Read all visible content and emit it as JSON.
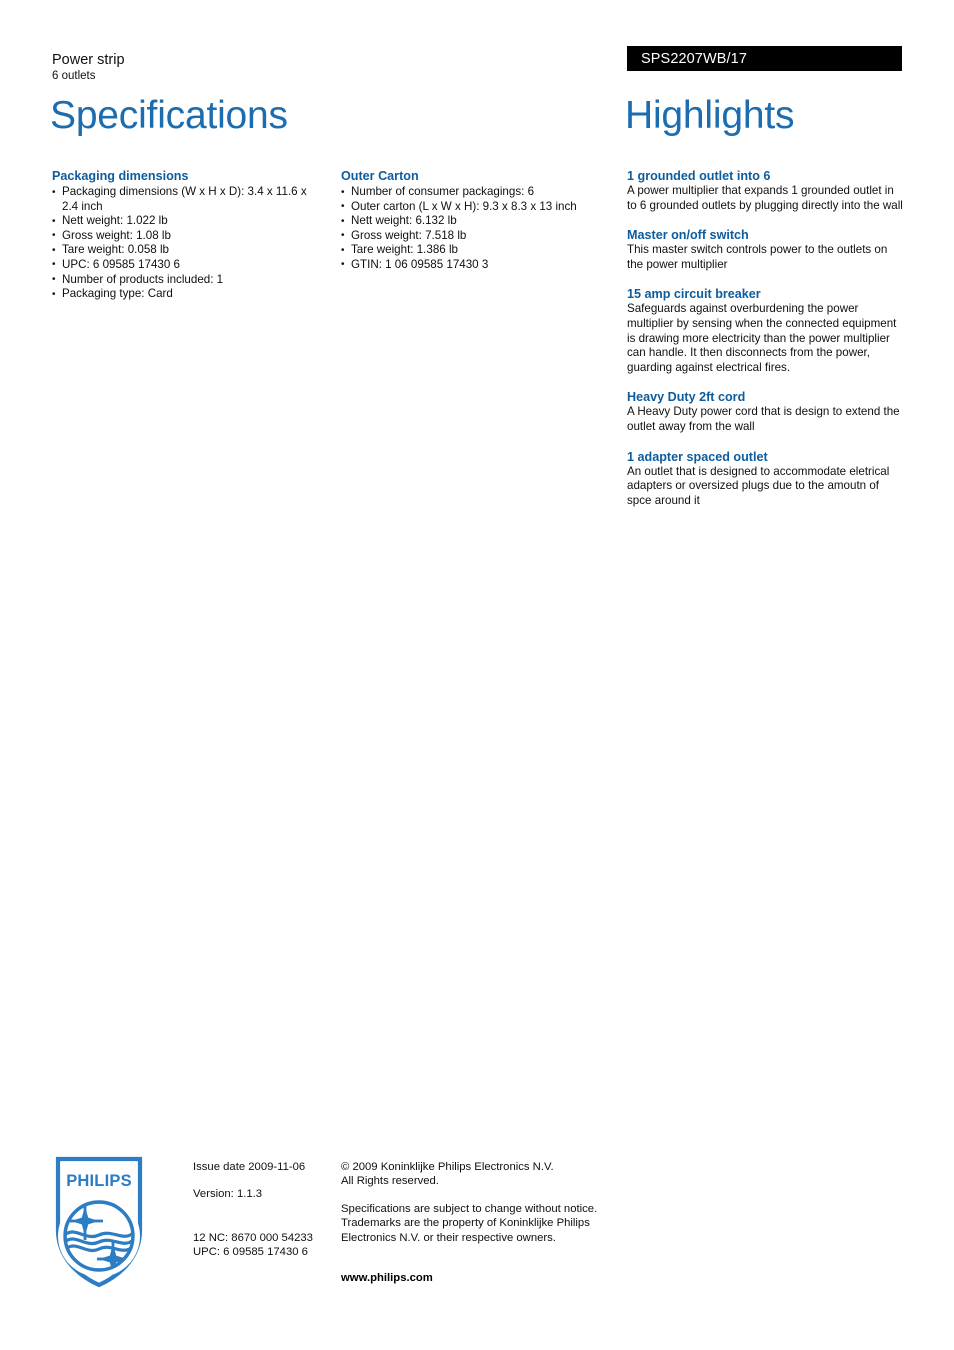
{
  "header": {
    "product_name": "Power strip",
    "product_subtitle": "6 outlets",
    "product_code": "SPS2207WB/17"
  },
  "titles": {
    "specifications": "Specifications",
    "highlights": "Highlights"
  },
  "colors": {
    "title_blue": "#1c6cb0",
    "heading_blue": "#0d5c9e",
    "banner_black": "#000000",
    "logo_blue": "#2d7dc4"
  },
  "specs": {
    "packaging": {
      "heading": "Packaging dimensions",
      "items": [
        "Packaging dimensions (W x H x D): 3.4 x 11.6 x 2.4 inch",
        "Nett weight: 1.022 lb",
        "Gross weight: 1.08 lb",
        "Tare weight: 0.058 lb",
        "UPC: 6 09585 17430 6",
        "Number of products included: 1",
        "Packaging type: Card"
      ]
    },
    "outer_carton": {
      "heading": "Outer Carton",
      "items": [
        "Number of consumer packagings: 6",
        "Outer carton (L x W x H): 9.3 x 8.3 x 13 inch",
        "Nett weight: 6.132 lb",
        "Gross weight: 7.518 lb",
        "Tare weight: 1.386 lb",
        "GTIN: 1 06 09585 17430 3"
      ]
    }
  },
  "highlights": [
    {
      "title": "1 grounded outlet into 6",
      "body": "A power multiplier that expands 1 grounded outlet in to 6 grounded outlets by plugging directly into the wall"
    },
    {
      "title": "Master on/off switch",
      "body": "This master switch controls power to the outlets on the power multiplier"
    },
    {
      "title": "15 amp circuit breaker",
      "body": "Safeguards against overburdening the power multiplier by sensing when the connected equipment is drawing more electricity than the power multiplier can handle. It then disconnects from the power, guarding against electrical fires."
    },
    {
      "title": "Heavy Duty 2ft cord",
      "body": "A Heavy Duty power cord that is design to extend the outlet away from the wall"
    },
    {
      "title": "1 adapter spaced outlet",
      "body": "An outlet that is designed to accommodate eletrical adapters or oversized plugs due to the amoutn of spce around it"
    }
  ],
  "footer": {
    "logo_wordmark": "PHILIPS",
    "issue_date": "Issue date 2009-11-06",
    "version": "Version: 1.1.3",
    "twelve_nc": "12 NC: 8670 000 54233",
    "upc": "UPC: 6 09585 17430 6",
    "copyright_line1": "© 2009 Koninklijke Philips Electronics N.V.",
    "copyright_line2": "All Rights reserved.",
    "disclaimer_line1": "Specifications are subject to change without notice.",
    "disclaimer_line2": "Trademarks are the property of Koninklijke Philips",
    "disclaimer_line3": "Electronics N.V. or their respective owners.",
    "website": "www.philips.com"
  }
}
